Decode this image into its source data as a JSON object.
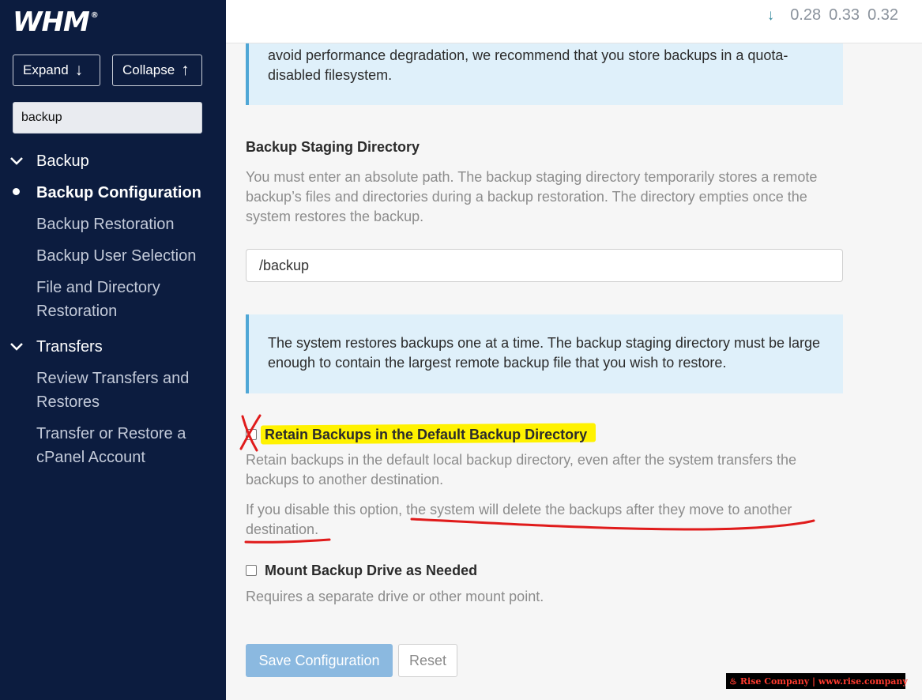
{
  "sidebar": {
    "logo": "WHM",
    "logo_mark": "®",
    "expand_label": "Expand",
    "collapse_label": "Collapse",
    "search_value": "backup",
    "sections": [
      {
        "title": "Backup",
        "items": [
          {
            "label": "Backup Configuration",
            "active": true
          },
          {
            "label": "Backup Restoration"
          },
          {
            "label": "Backup User Selection"
          },
          {
            "label": "File and Directory Restoration"
          }
        ]
      },
      {
        "title": "Transfers",
        "items": [
          {
            "label": "Review Transfers and Restores"
          },
          {
            "label": "Transfer or Restore a cPanel Account"
          }
        ]
      }
    ]
  },
  "topbar": {
    "load_icon": "arrow-down-icon",
    "load": [
      "0.28",
      "0.33",
      "0.32"
    ]
  },
  "main": {
    "info_top": "avoid performance degradation, we recommend that you store backups in a quota-disabled filesystem.",
    "staging": {
      "label": "Backup Staging Directory",
      "help": "You must enter an absolute path. The backup staging directory temporarily stores a remote backup’s files and directories during a backup restoration. The directory empties once the system restores the backup.",
      "value": "/backup"
    },
    "info_mid": "The system restores backups one at a time. The backup staging directory must be large enough to contain the largest remote backup file that you wish to restore.",
    "retain": {
      "label": "Retain Backups in the Default Backup Directory",
      "checked": false,
      "help1": "Retain backups in the default local backup directory, even after the system transfers the backups to another destination.",
      "help2_a": "If you disable this option, ",
      "help2_b": "the system will delete the backups after they move to another destination."
    },
    "mount": {
      "label": "Mount Backup Drive as Needed",
      "checked": false,
      "help": "Requires a separate drive or other mount point."
    },
    "save_label": "Save Configuration",
    "reset_label": "Reset"
  },
  "watermark": "Rise Company | www.rise.company",
  "colors": {
    "sidebar_bg": "#0c1c3f",
    "highlight": "#fff200",
    "annotation_red": "#e01b1b",
    "info_bg": "#dff0fa",
    "save_btn": "#8bb9e0"
  }
}
